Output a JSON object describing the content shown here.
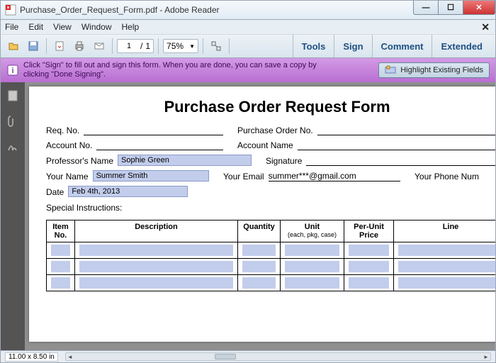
{
  "window": {
    "title": "Purchase_Order_Request_Form.pdf - Adobe Reader"
  },
  "menu": {
    "file": "File",
    "edit": "Edit",
    "view": "View",
    "window": "Window",
    "help": "Help"
  },
  "toolbar": {
    "page_current": "1",
    "page_sep": "/",
    "page_total": "1",
    "zoom": "75%",
    "actions": {
      "tools": "Tools",
      "sign": "Sign",
      "comment": "Comment",
      "extended": "Extended"
    }
  },
  "signbar": {
    "msg": "Click \"Sign\" to fill out and sign this form. When you are done, you can save a copy by clicking \"Done Signing\".",
    "highlight": "Highlight Existing Fields"
  },
  "form": {
    "title": "Purchase Order Request Form",
    "labels": {
      "req_no": "Req. No.",
      "po_no": "Purchase Order No.",
      "account_no": "Account No.",
      "account_name": "Account Name",
      "prof_name": "Professor's Name",
      "signature": "Signature",
      "your_name": "Your Name",
      "your_email": "Your Email",
      "your_phone": "Your Phone Num",
      "date": "Date",
      "special": "Special Instructions:"
    },
    "values": {
      "prof_name": "Sophie Green",
      "your_name": "Summer Smith",
      "your_email": "summer***@gmail.com",
      "date": "Feb 4th, 2013"
    },
    "columns": {
      "item_no": "Item No.",
      "description": "Description",
      "quantity": "Quantity",
      "unit": "Unit",
      "unit_sub": "(each, pkg, case)",
      "per_unit": "Per-Unit Price",
      "line": "Line"
    }
  },
  "status": {
    "dims": "11.00 x 8.50 in"
  }
}
